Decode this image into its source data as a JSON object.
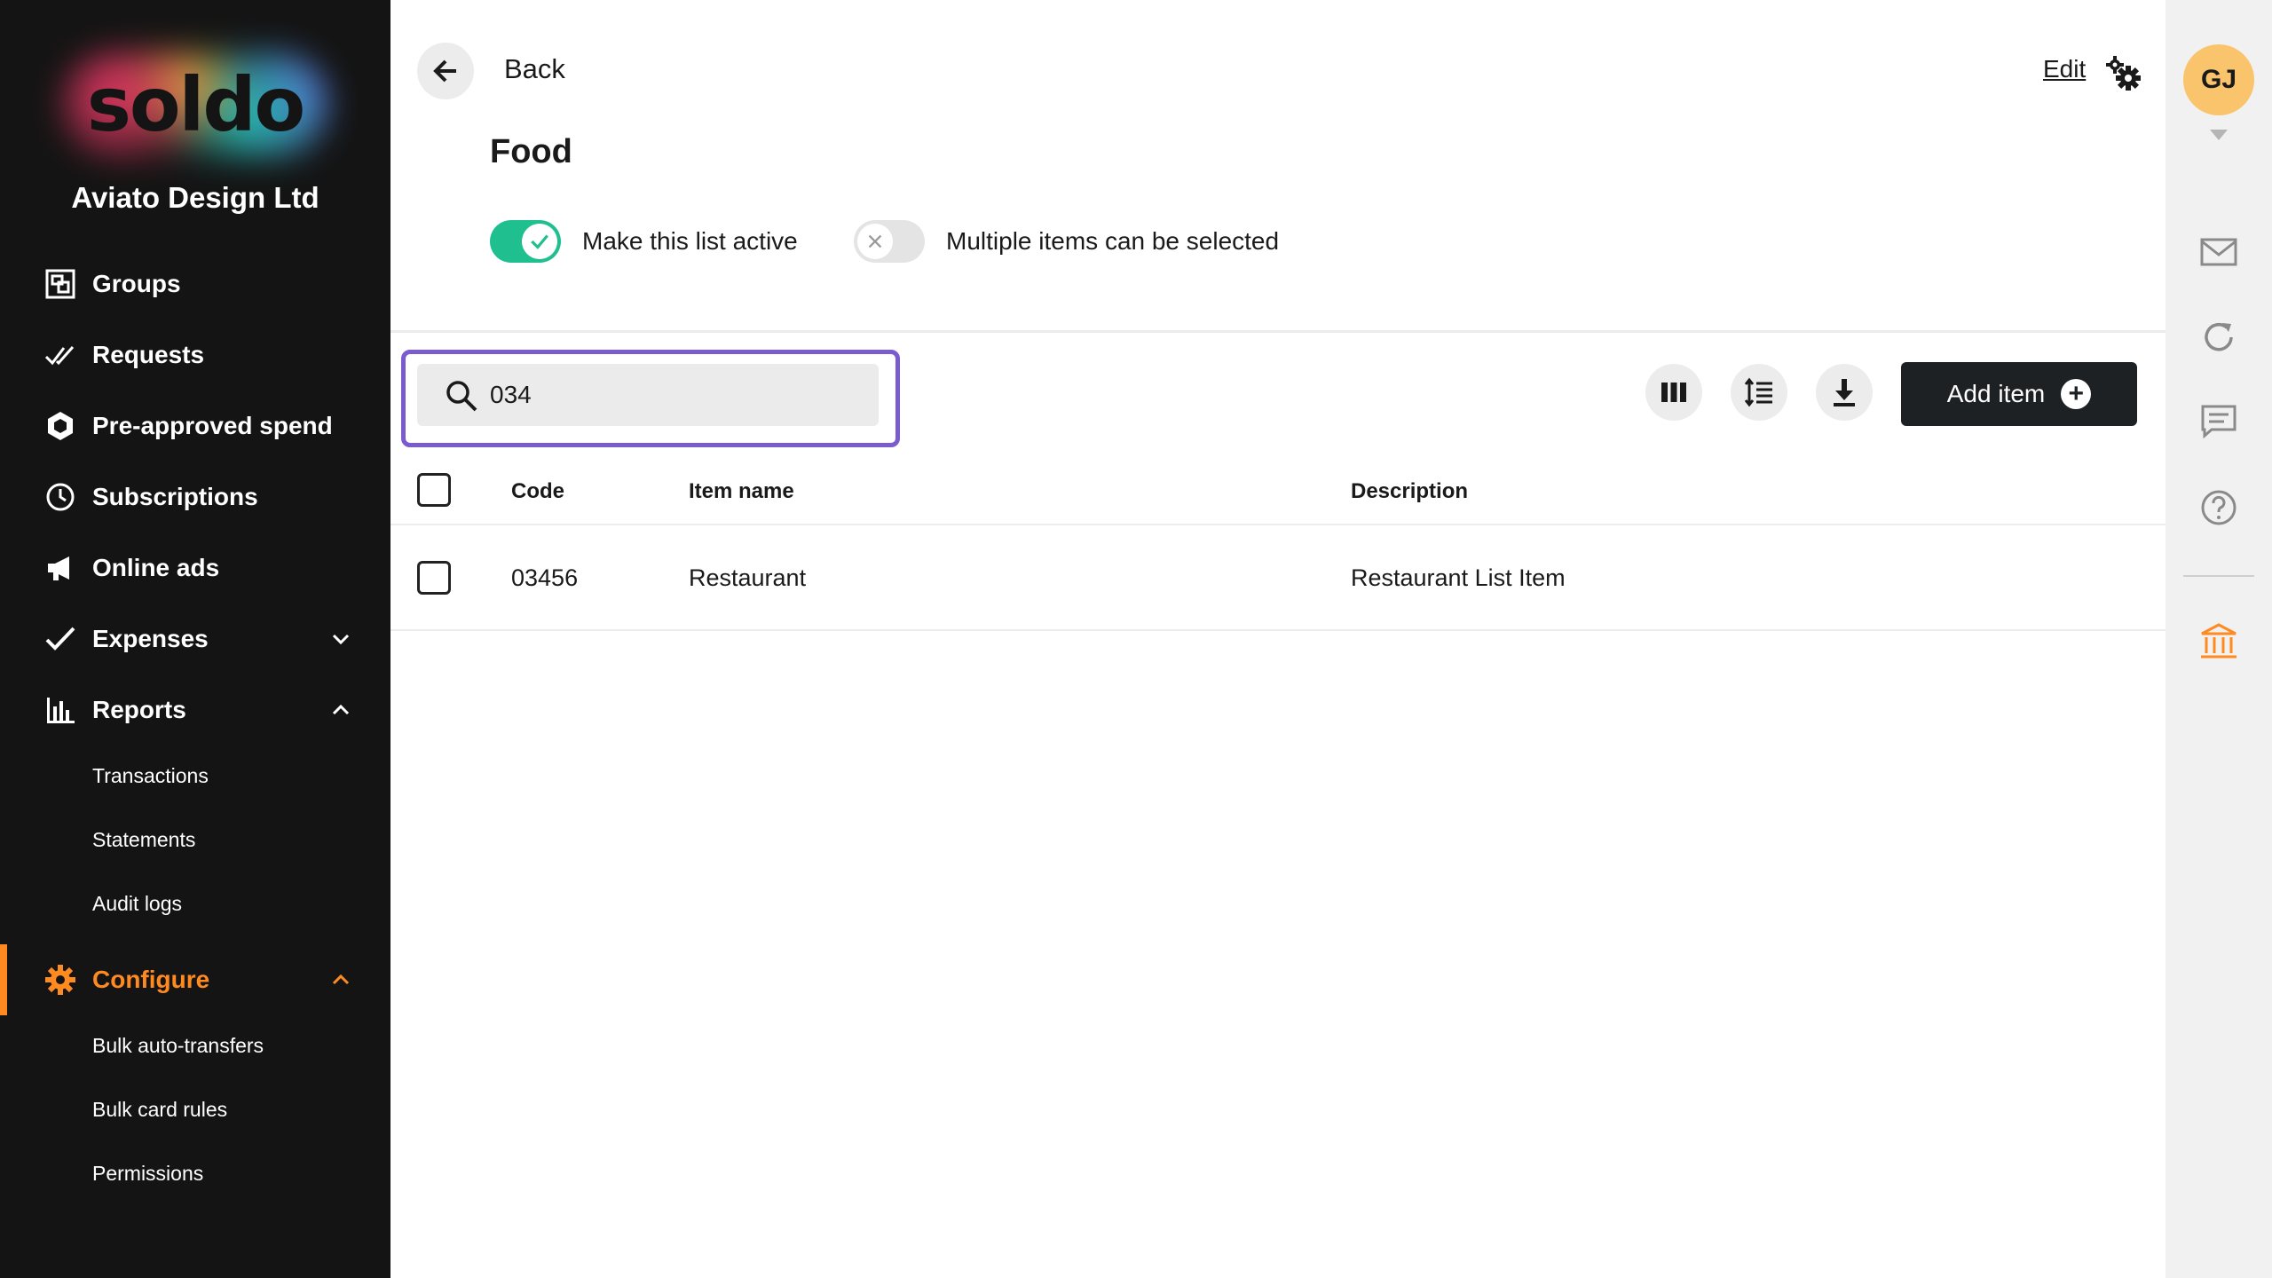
{
  "sidebar": {
    "logo_text": "soldo",
    "company": "Aviato Design Ltd",
    "items": [
      {
        "label": "Groups",
        "icon": "groups-icon"
      },
      {
        "label": "Requests",
        "icon": "double-check-icon"
      },
      {
        "label": "Pre-approved spend",
        "icon": "hexagon-icon"
      },
      {
        "label": "Subscriptions",
        "icon": "clock-icon"
      },
      {
        "label": "Online ads",
        "icon": "megaphone-icon"
      },
      {
        "label": "Expenses",
        "icon": "check-icon"
      },
      {
        "label": "Reports",
        "icon": "bar-chart-icon"
      },
      {
        "label": "Configure",
        "icon": "gear-icon"
      }
    ],
    "reports_sub": [
      "Transactions",
      "Statements",
      "Audit logs"
    ],
    "configure_sub": [
      "Bulk auto-transfers",
      "Bulk card rules",
      "Permissions"
    ],
    "accent_color": "#ff8a1f"
  },
  "header": {
    "back_label": "Back",
    "edit_label": "Edit",
    "title": "Food"
  },
  "toggles": {
    "active_label": "Make this list active",
    "active_on": true,
    "multiple_label": "Multiple items can be selected",
    "multiple_on": false
  },
  "toolbar": {
    "search_value": "034",
    "add_item_label": "Add item"
  },
  "table": {
    "headers": {
      "code": "Code",
      "item_name": "Item name",
      "description": "Description"
    },
    "rows": [
      {
        "code": "03456",
        "item_name": "Restaurant",
        "description": "Restaurant List Item"
      }
    ]
  },
  "rail": {
    "avatar_initials": "GJ"
  }
}
